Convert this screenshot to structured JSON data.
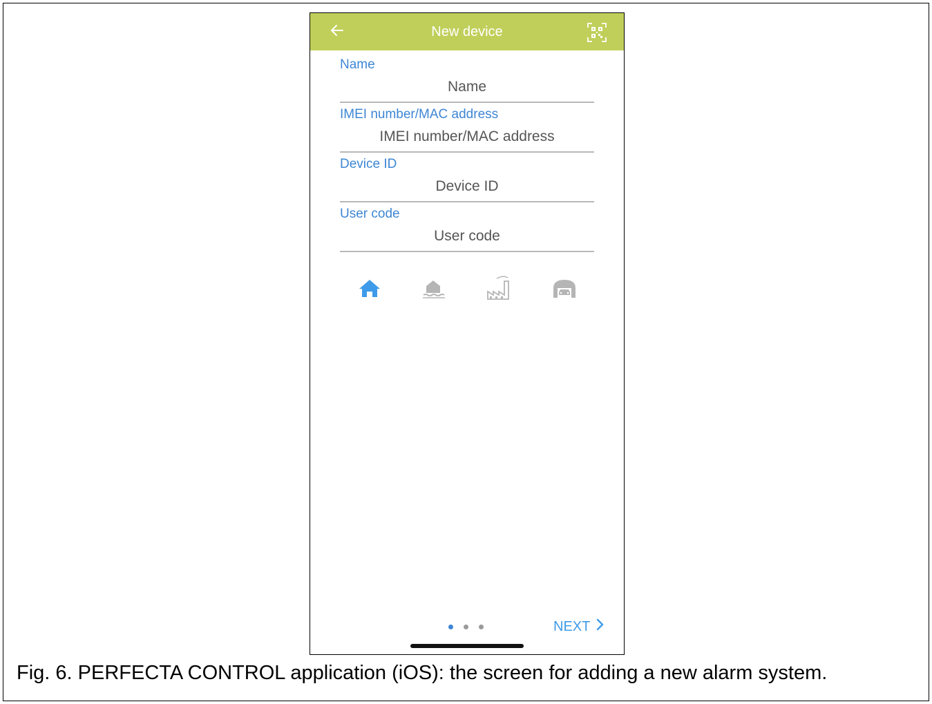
{
  "header": {
    "title": "New device",
    "back_icon": "back-arrow-icon",
    "qr_icon": "qr-code-scan-icon",
    "bg_color": "#c0cf5a"
  },
  "form": {
    "fields": [
      {
        "label": "Name",
        "placeholder": "Name",
        "value": ""
      },
      {
        "label": "IMEI number/MAC address",
        "placeholder": "IMEI number/MAC address",
        "value": ""
      },
      {
        "label": "Device ID",
        "placeholder": "Device ID",
        "value": ""
      },
      {
        "label": "User code",
        "placeholder": "User code",
        "value": ""
      }
    ],
    "label_color": "#3d86d4"
  },
  "object_types": [
    {
      "icon": "house-icon",
      "selected": true
    },
    {
      "icon": "lakeside-house-icon",
      "selected": false
    },
    {
      "icon": "factory-icon",
      "selected": false
    },
    {
      "icon": "garage-icon",
      "selected": false
    }
  ],
  "pager": {
    "current": 1,
    "total": 3
  },
  "footer": {
    "next_label": "NEXT",
    "accent_color": "#3d9be9"
  },
  "caption": "Fig. 6. PERFECTA CONTROL application (iOS): the screen for adding a new alarm system."
}
